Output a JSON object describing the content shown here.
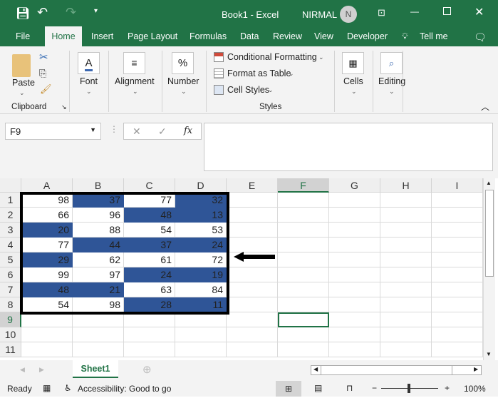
{
  "titlebar": {
    "doc_title": "Book1  -  Excel",
    "user": "NIRMAL",
    "avatar_initial": "N"
  },
  "tabs": [
    "File",
    "Home",
    "Insert",
    "Page Layout",
    "Formulas",
    "Data",
    "Review",
    "View",
    "Developer",
    "Tell me"
  ],
  "ribbon": {
    "paste": "Paste",
    "clipboard": "Clipboard",
    "font": "Font",
    "alignment": "Alignment",
    "number": "Number",
    "conditional_formatting": "Conditional Formatting",
    "format_as_table": "Format as Table",
    "cell_styles": "Cell Styles",
    "styles": "Styles",
    "cells": "Cells",
    "editing": "Editing",
    "font_glyph": "A",
    "number_glyph": "%"
  },
  "formula_bar": {
    "name_box": "F9",
    "fx": "fx",
    "value": ""
  },
  "columns": [
    "A",
    "B",
    "C",
    "D",
    "E",
    "F",
    "G",
    "H",
    "I"
  ],
  "rows": [
    "1",
    "2",
    "3",
    "4",
    "5",
    "6",
    "7",
    "8",
    "9",
    "10",
    "11"
  ],
  "cells": [
    [
      98,
      37,
      77,
      32
    ],
    [
      66,
      96,
      48,
      13
    ],
    [
      20,
      88,
      54,
      53
    ],
    [
      77,
      44,
      37,
      24
    ],
    [
      29,
      62,
      61,
      72
    ],
    [
      99,
      97,
      24,
      19
    ],
    [
      48,
      21,
      63,
      84
    ],
    [
      54,
      98,
      28,
      11
    ]
  ],
  "highlighted": [
    [
      false,
      true,
      false,
      true
    ],
    [
      false,
      false,
      true,
      true
    ],
    [
      true,
      false,
      false,
      false
    ],
    [
      false,
      true,
      true,
      true
    ],
    [
      true,
      false,
      false,
      false
    ],
    [
      false,
      false,
      true,
      true
    ],
    [
      true,
      true,
      false,
      false
    ],
    [
      false,
      false,
      true,
      true
    ]
  ],
  "selected_cell": "F9",
  "colors": {
    "accent": "#217346",
    "highlight": "#2f5597"
  },
  "sheet_tabs": [
    "Sheet1"
  ],
  "status": {
    "ready": "Ready",
    "accessibility": "Accessibility: Good to go",
    "zoom": "100%"
  }
}
